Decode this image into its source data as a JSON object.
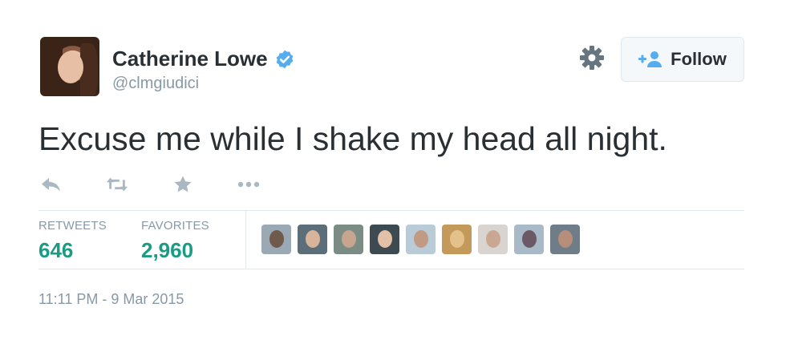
{
  "user": {
    "name": "Catherine Lowe",
    "handle": "@clmgiudici",
    "verified": true
  },
  "follow_button": {
    "label": "Follow"
  },
  "tweet": {
    "text": "Excuse me while I shake my head all night."
  },
  "stats": {
    "retweets_label": "RETWEETS",
    "retweets_value": "646",
    "favorites_label": "FAVORITES",
    "favorites_value": "2,960"
  },
  "favoriters": [
    {
      "bg": "#9aa9b4",
      "face": "#6f5a4c"
    },
    {
      "bg": "#5b6e7a",
      "face": "#d8b49a"
    },
    {
      "bg": "#7b8c84",
      "face": "#c7a58e"
    },
    {
      "bg": "#3e4a52",
      "face": "#e2c1a6"
    },
    {
      "bg": "#b8cbd6",
      "face": "#c19a84"
    },
    {
      "bg": "#c49a5a",
      "face": "#e4c18a"
    },
    {
      "bg": "#d9d4cf",
      "face": "#c9a792"
    },
    {
      "bg": "#a8b9c8",
      "face": "#6b5a66"
    },
    {
      "bg": "#6e7d88",
      "face": "#b78e7a"
    }
  ],
  "timestamp": "11:11 PM - 9 Mar 2015",
  "colors": {
    "accent_green": "#1b9a84",
    "verified_blue": "#55acee",
    "muted_gray": "#8899a6",
    "icon_gray": "#aab8c2"
  },
  "icons": [
    "reply-icon",
    "retweet-icon",
    "favorite-star-icon",
    "more-icon",
    "gear-icon",
    "follow-person-icon",
    "verified-badge-icon"
  ]
}
